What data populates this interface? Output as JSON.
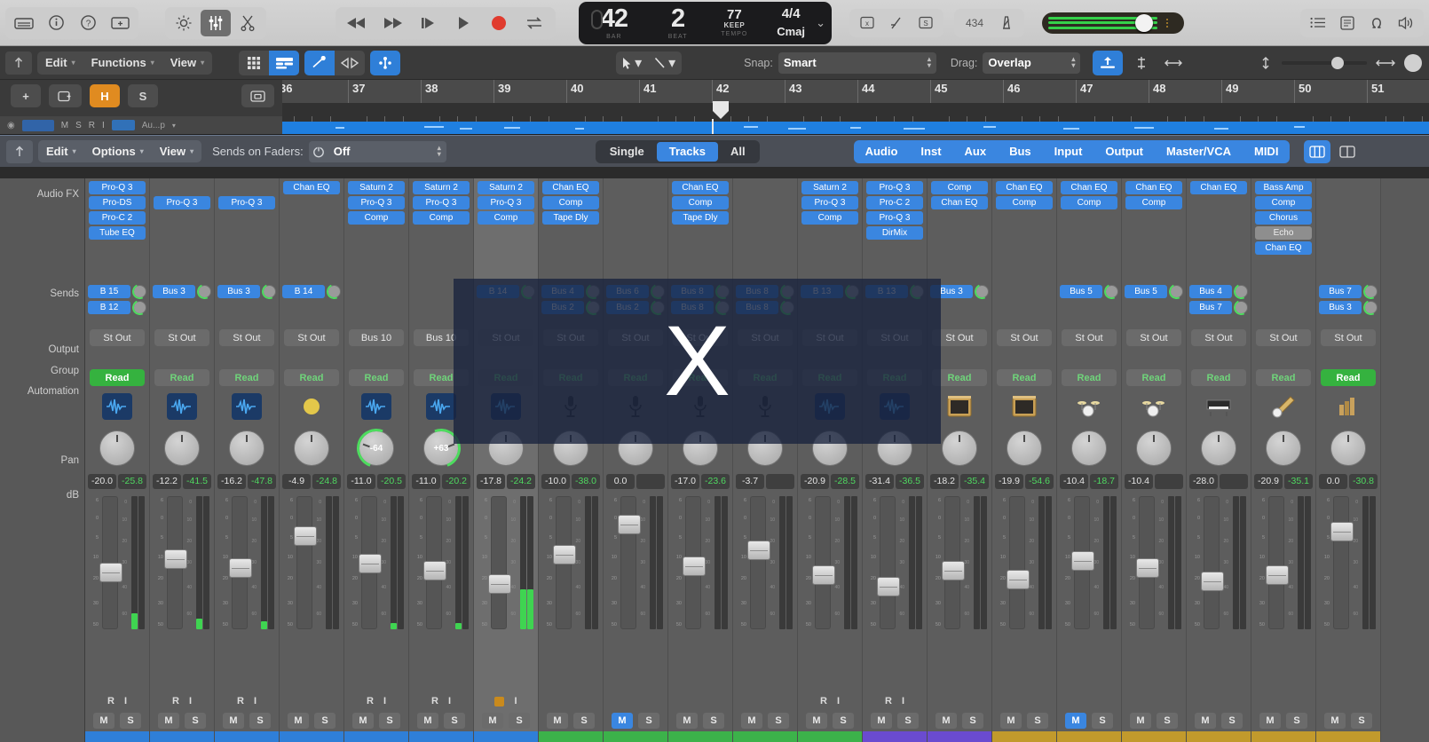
{
  "app": {
    "title": "Logic Pro Mixer"
  },
  "toolbar": {
    "left_icons": [
      {
        "name": "library-icon",
        "glyph": "library"
      },
      {
        "name": "info-icon",
        "glyph": "info"
      },
      {
        "name": "help-icon",
        "glyph": "help"
      },
      {
        "name": "media-icon",
        "glyph": "media"
      }
    ],
    "view_icons": [
      {
        "name": "smart-controls-icon",
        "glyph": "knob",
        "active": false
      },
      {
        "name": "mixer-icon",
        "glyph": "faders",
        "active": true
      },
      {
        "name": "editors-icon",
        "glyph": "scissors",
        "active": false
      }
    ],
    "transport": [
      {
        "name": "rewind-button",
        "glyph": "rewind"
      },
      {
        "name": "forward-button",
        "glyph": "forward"
      },
      {
        "name": "go-to-beginning-button",
        "glyph": "skip-start"
      },
      {
        "name": "play-button",
        "glyph": "play"
      },
      {
        "name": "record-button",
        "glyph": "record"
      },
      {
        "name": "cycle-button",
        "glyph": "cycle"
      }
    ],
    "lcd": {
      "bar_value": "42",
      "bar_label": "BAR",
      "beat_value": "2",
      "beat_label": "BEAT",
      "tempo_value": "77",
      "tempo_mode": "KEEP",
      "tempo_label": "TEMPO",
      "signature": "4/4",
      "key": "Cmaj"
    },
    "mini_icons": [
      {
        "name": "count-in-icon",
        "glyph": "countin"
      },
      {
        "name": "tuner-icon",
        "glyph": "tuner"
      },
      {
        "name": "solo-icon",
        "glyph": "solo"
      }
    ],
    "mini_icons2": [
      {
        "name": "cpu-meter-label",
        "glyph": "text",
        "text": "434"
      },
      {
        "name": "metronome-icon",
        "glyph": "metronome"
      }
    ],
    "master_volume": {
      "name": "master-volume-slider",
      "value": 66
    },
    "right_icons": [
      {
        "name": "list-editors-icon",
        "glyph": "list"
      },
      {
        "name": "notes-icon",
        "glyph": "note-pad"
      },
      {
        "name": "loop-browser-icon",
        "glyph": "omega"
      },
      {
        "name": "media-browser-icon",
        "glyph": "speaker"
      }
    ]
  },
  "editor_bar": {
    "back_icon": "back-arrow-icon",
    "menus": [
      {
        "label": "Edit",
        "name": "menu-edit"
      },
      {
        "label": "Functions",
        "name": "menu-functions"
      },
      {
        "label": "View",
        "name": "menu-view"
      }
    ],
    "view_buttons": [
      {
        "name": "grid-view-button",
        "glyph": "grid",
        "active": false
      },
      {
        "name": "track-view-button",
        "glyph": "tracks",
        "active": true
      },
      {
        "name": "flex-button",
        "glyph": "flex",
        "active": true
      },
      {
        "name": "fade-button",
        "glyph": "fade",
        "active": false
      },
      {
        "name": "flex-pitch-button",
        "glyph": "flexpitch",
        "active": true
      }
    ],
    "tools": [
      {
        "name": "pointer-tool",
        "glyph": "pointer"
      },
      {
        "name": "line-tool",
        "glyph": "line"
      }
    ],
    "snap": {
      "label": "Snap:",
      "value": "Smart",
      "name": "snap-popup"
    },
    "drag": {
      "label": "Drag:",
      "value": "Overlap",
      "name": "drag-popup"
    },
    "right_buttons": [
      {
        "name": "catch-playhead-button",
        "glyph": "catch",
        "active": true
      },
      {
        "name": "align-button",
        "glyph": "align",
        "active": false
      },
      {
        "name": "fit-button",
        "glyph": "fit",
        "active": false
      }
    ],
    "zoom_slider_name": "zoom-slider"
  },
  "track_header": {
    "buttons": [
      {
        "label": "+",
        "name": "add-track-button",
        "style": "plain"
      },
      {
        "label": "",
        "name": "duplicate-track-button",
        "style": "icon"
      },
      {
        "label": "H",
        "name": "hide-button",
        "style": "orange"
      },
      {
        "label": "S",
        "name": "solo-group-button",
        "style": "plain"
      },
      {
        "label": "",
        "name": "automation-button",
        "style": "icon"
      }
    ]
  },
  "ruler": {
    "bars": [
      "36",
      "37",
      "38",
      "39",
      "40",
      "41",
      "42",
      "43",
      "44",
      "45",
      "46",
      "47",
      "48",
      "49",
      "50",
      "51"
    ],
    "playhead_bar": "42"
  },
  "mixer_bar": {
    "back_icon": "back-arrow-icon",
    "menus": [
      {
        "label": "Edit",
        "name": "mixer-menu-edit"
      },
      {
        "label": "Options",
        "name": "mixer-menu-options"
      },
      {
        "label": "View",
        "name": "mixer-menu-view"
      }
    ],
    "sends_on_faders": {
      "label": "Sends on Faders:",
      "power_icon": "power-icon",
      "value": "Off",
      "name": "sends-on-faders-popup"
    },
    "scope": [
      {
        "label": "Single",
        "name": "scope-single",
        "active": false
      },
      {
        "label": "Tracks",
        "name": "scope-tracks",
        "active": true
      },
      {
        "label": "All",
        "name": "scope-all",
        "active": false
      }
    ],
    "filters": [
      {
        "label": "Audio",
        "name": "filter-audio"
      },
      {
        "label": "Inst",
        "name": "filter-inst"
      },
      {
        "label": "Aux",
        "name": "filter-aux"
      },
      {
        "label": "Bus",
        "name": "filter-bus"
      },
      {
        "label": "Input",
        "name": "filter-input"
      },
      {
        "label": "Output",
        "name": "filter-output"
      },
      {
        "label": "Master/VCA",
        "name": "filter-master-vca"
      },
      {
        "label": "MIDI",
        "name": "filter-midi"
      }
    ],
    "view_toggles": [
      {
        "name": "channel-strip-view-toggle",
        "active": true
      },
      {
        "name": "narrow-strip-view-toggle",
        "active": false
      }
    ]
  },
  "row_labels": [
    {
      "label": "Audio FX",
      "name": "row-label-audio-fx"
    },
    {
      "label": "Sends",
      "name": "row-label-sends"
    },
    {
      "label": "Output",
      "name": "row-label-output"
    },
    {
      "label": "Group",
      "name": "row-label-group"
    },
    {
      "label": "Automation",
      "name": "row-label-automation"
    },
    {
      "label": "Pan",
      "name": "row-label-pan"
    },
    {
      "label": "dB",
      "name": "row-label-db"
    }
  ],
  "channels": [
    {
      "fx": [
        "Pro-Q 3",
        "Pro-DS",
        "Pro-C 2",
        "Tube EQ"
      ],
      "sends": [
        {
          "bus": "B 15"
        },
        {
          "bus": "B 12"
        }
      ],
      "output": "St Out",
      "automation": "Read",
      "automation_active": true,
      "icon": "waveform-icon",
      "icon_style": "blue",
      "pan": null,
      "pan_deg": 0,
      "db": "-20.0",
      "meter": "-25.8",
      "meter_green": true,
      "fader": 0.42,
      "meterL": 0.12,
      "meterR": 0.0,
      "ri": true,
      "mute": false,
      "solo": false,
      "color": "#2f7fd8",
      "selected": false
    },
    {
      "fx": [
        "",
        "Pro-Q 3",
        "",
        ""
      ],
      "sends": [
        {
          "bus": "Bus 3"
        }
      ],
      "output": "St Out",
      "automation": "Read",
      "automation_active": false,
      "icon": "waveform-icon",
      "icon_style": "blue",
      "pan": null,
      "pan_deg": 0,
      "db": "-12.2",
      "meter": "-41.5",
      "meter_green": true,
      "fader": 0.54,
      "meterL": 0.08,
      "meterR": 0.0,
      "ri": true,
      "mute": false,
      "solo": false,
      "color": "#2f7fd8",
      "selected": false
    },
    {
      "fx": [
        "",
        "Pro-Q 3",
        "",
        ""
      ],
      "sends": [
        {
          "bus": "Bus 3"
        }
      ],
      "output": "St Out",
      "automation": "Read",
      "automation_active": false,
      "icon": "waveform-icon",
      "icon_style": "blue",
      "pan": null,
      "pan_deg": 0,
      "db": "-16.2",
      "meter": "-47.8",
      "meter_green": true,
      "fader": 0.46,
      "meterL": 0.06,
      "meterR": 0.0,
      "ri": true,
      "mute": false,
      "solo": false,
      "color": "#2f7fd8",
      "selected": false
    },
    {
      "fx": [
        "Chan EQ",
        "",
        "",
        ""
      ],
      "sends": [
        {
          "bus": "B 14"
        }
      ],
      "output": "St Out",
      "automation": "Read",
      "automation_active": false,
      "icon": "drum-icon",
      "icon_style": "yellow",
      "pan": null,
      "pan_deg": 0,
      "db": "-4.9",
      "meter": "-24.8",
      "meter_green": true,
      "fader": 0.74,
      "meterL": 0.0,
      "meterR": 0.0,
      "ri": false,
      "mute": false,
      "solo": false,
      "color": "#2f7fd8",
      "selected": false
    },
    {
      "fx": [
        "Saturn 2",
        "Pro-Q 3",
        "Comp",
        ""
      ],
      "sends": [],
      "output": "Bus 10",
      "automation": "Read",
      "automation_active": false,
      "icon": "waveform-icon",
      "icon_style": "blue",
      "pan": "-64",
      "pan_deg": -70,
      "db": "-11.0",
      "meter": "-20.5",
      "meter_green": true,
      "fader": 0.5,
      "meterL": 0.05,
      "meterR": 0.0,
      "ri": true,
      "mute": false,
      "solo": false,
      "color": "#2f7fd8",
      "selected": false
    },
    {
      "fx": [
        "Saturn 2",
        "Pro-Q 3",
        "Comp",
        ""
      ],
      "sends": [],
      "output": "Bus 10",
      "automation": "Read",
      "automation_active": false,
      "icon": "waveform-icon",
      "icon_style": "blue",
      "pan": "+63",
      "pan_deg": 70,
      "db": "-11.0",
      "meter": "-20.2",
      "meter_green": true,
      "fader": 0.44,
      "meterL": 0.05,
      "meterR": 0.0,
      "ri": true,
      "mute": false,
      "solo": false,
      "color": "#2f7fd8",
      "selected": false
    },
    {
      "fx": [
        "Saturn 2",
        "Pro-Q 3",
        "Comp",
        ""
      ],
      "sends": [
        {
          "bus": "B 14"
        }
      ],
      "output": "St Out",
      "automation": "Read",
      "automation_active": false,
      "icon": "waveform-icon",
      "icon_style": "blue",
      "pan": null,
      "pan_deg": 0,
      "db": "-17.8",
      "meter": "-24.2",
      "meter_green": true,
      "fader": 0.32,
      "meterL": 0.3,
      "meterR": 0.3,
      "ri": false,
      "mute": false,
      "solo": false,
      "color": "#2f7fd8",
      "selected": true
    },
    {
      "fx": [
        "Chan EQ",
        "Comp",
        "Tape Dly",
        ""
      ],
      "sends": [
        {
          "bus": "Bus 4"
        },
        {
          "bus": "Bus 2"
        }
      ],
      "output": "St Out",
      "automation": "Read",
      "automation_active": false,
      "icon": "mic-icon",
      "icon_style": "dark",
      "pan": null,
      "pan_deg": 0,
      "db": "-10.0",
      "meter": "-38.0",
      "meter_green": true,
      "fader": 0.58,
      "meterL": 0.0,
      "meterR": 0.0,
      "ri": false,
      "mute": false,
      "solo": false,
      "color": "#3cb24a",
      "selected": false
    },
    {
      "fx": [
        "",
        "",
        "",
        ""
      ],
      "sends": [
        {
          "bus": "Bus 6"
        },
        {
          "bus": "Bus 2"
        }
      ],
      "output": "St Out",
      "automation": "Read",
      "automation_active": false,
      "icon": "mic-icon",
      "icon_style": "dark",
      "pan": null,
      "pan_deg": 0,
      "db": "0.0",
      "meter": "",
      "meter_green": true,
      "fader": 0.84,
      "meterL": 0.0,
      "meterR": 0.0,
      "ri": false,
      "mute": true,
      "solo": false,
      "color": "#3cb24a",
      "selected": false
    },
    {
      "fx": [
        "Chan EQ",
        "Comp",
        "Tape Dly",
        ""
      ],
      "sends": [
        {
          "bus": "Bus 8"
        },
        {
          "bus": "Bus 8"
        }
      ],
      "output": "St Out",
      "automation": "Read",
      "automation_active": false,
      "icon": "mic-icon",
      "icon_style": "dark",
      "pan": null,
      "pan_deg": 0,
      "db": "-17.0",
      "meter": "-23.6",
      "meter_green": true,
      "fader": 0.48,
      "meterL": 0.0,
      "meterR": 0.0,
      "ri": false,
      "mute": false,
      "solo": false,
      "color": "#3cb24a",
      "selected": false
    },
    {
      "fx": [
        "",
        "",
        "",
        ""
      ],
      "sends": [
        {
          "bus": "Bus 8"
        },
        {
          "bus": "Bus 8"
        }
      ],
      "output": "St Out",
      "automation": "Read",
      "automation_active": false,
      "icon": "mic-icon",
      "icon_style": "dark",
      "pan": null,
      "pan_deg": 0,
      "db": "-3.7",
      "meter": "",
      "meter_green": true,
      "fader": 0.62,
      "meterL": 0.0,
      "meterR": 0.0,
      "ri": false,
      "mute": false,
      "solo": false,
      "color": "#3cb24a",
      "selected": false
    },
    {
      "fx": [
        "Saturn 2",
        "Pro-Q 3",
        "Comp",
        ""
      ],
      "sends": [
        {
          "bus": "B 13"
        }
      ],
      "output": "St Out",
      "automation": "Read",
      "automation_active": false,
      "icon": "waveform-icon",
      "icon_style": "blue",
      "pan": null,
      "pan_deg": 0,
      "db": "-20.9",
      "meter": "-28.5",
      "meter_green": true,
      "fader": 0.4,
      "meterL": 0.0,
      "meterR": 0.0,
      "ri": true,
      "mute": false,
      "solo": false,
      "color": "#3cb24a",
      "selected": false
    },
    {
      "fx": [
        "Pro-Q 3",
        "Pro-C 2",
        "Pro-Q 3",
        "DirMix"
      ],
      "sends": [
        {
          "bus": "B 13"
        }
      ],
      "output": "St Out",
      "automation": "Read",
      "automation_active": false,
      "icon": "waveform-icon",
      "icon_style": "blue",
      "pan": null,
      "pan_deg": 0,
      "db": "-31.4",
      "meter": "-36.5",
      "meter_green": true,
      "fader": 0.3,
      "meterL": 0.0,
      "meterR": 0.0,
      "ri": true,
      "mute": false,
      "solo": false,
      "color": "#6a4bd0",
      "selected": false
    },
    {
      "fx": [
        "Comp",
        "Chan EQ",
        "",
        ""
      ],
      "sends": [
        {
          "bus": "Bus 3"
        }
      ],
      "output": "St Out",
      "automation": "Read",
      "automation_active": false,
      "icon": "amp-icon",
      "icon_style": "img",
      "pan": null,
      "pan_deg": 0,
      "db": "-18.2",
      "meter": "-35.4",
      "meter_green": true,
      "fader": 0.44,
      "meterL": 0.0,
      "meterR": 0.0,
      "ri": false,
      "mute": false,
      "solo": false,
      "color": "#6a4bd0",
      "selected": false
    },
    {
      "fx": [
        "Chan EQ",
        "Comp",
        "",
        ""
      ],
      "sends": [],
      "output": "St Out",
      "automation": "Read",
      "automation_active": false,
      "icon": "amp-icon",
      "icon_style": "img",
      "pan": null,
      "pan_deg": 0,
      "db": "-19.9",
      "meter": "-54.6",
      "meter_green": true,
      "fader": 0.36,
      "meterL": 0.0,
      "meterR": 0.0,
      "ri": false,
      "mute": false,
      "solo": false,
      "color": "#c29a2c",
      "selected": false
    },
    {
      "fx": [
        "Chan EQ",
        "Comp",
        "",
        ""
      ],
      "sends": [
        {
          "bus": "Bus 5"
        }
      ],
      "output": "St Out",
      "automation": "Read",
      "automation_active": false,
      "icon": "drumkit-icon",
      "icon_style": "img",
      "pan": null,
      "pan_deg": 0,
      "db": "-10.4",
      "meter": "-18.7",
      "meter_green": true,
      "fader": 0.52,
      "meterL": 0.0,
      "meterR": 0.0,
      "ri": false,
      "mute": true,
      "solo": false,
      "color": "#c29a2c",
      "selected": false
    },
    {
      "fx": [
        "Chan EQ",
        "Comp",
        "",
        ""
      ],
      "sends": [
        {
          "bus": "Bus 5"
        }
      ],
      "output": "St Out",
      "automation": "Read",
      "automation_active": false,
      "icon": "drumkit-icon",
      "icon_style": "img",
      "pan": null,
      "pan_deg": 0,
      "db": "-10.4",
      "meter": "",
      "meter_green": true,
      "fader": 0.46,
      "meterL": 0.0,
      "meterR": 0.0,
      "ri": false,
      "mute": false,
      "solo": false,
      "color": "#c29a2c",
      "selected": false
    },
    {
      "fx": [
        "Chan EQ",
        "",
        "",
        ""
      ],
      "sends": [
        {
          "bus": "Bus 4"
        },
        {
          "bus": "Bus 7"
        }
      ],
      "output": "St Out",
      "automation": "Read",
      "automation_active": false,
      "icon": "piano-icon",
      "icon_style": "img",
      "pan": null,
      "pan_deg": 0,
      "db": "-28.0",
      "meter": "",
      "meter_green": true,
      "fader": 0.34,
      "meterL": 0.0,
      "meterR": 0.0,
      "ri": false,
      "mute": false,
      "solo": false,
      "color": "#c29a2c",
      "selected": false
    },
    {
      "fx": [
        "Bass Amp",
        "Comp",
        "Chorus",
        "Echo",
        "Chan EQ"
      ],
      "sends": [],
      "output": "St Out",
      "automation": "Read",
      "automation_active": false,
      "icon": "guitar-icon",
      "icon_style": "img",
      "pan": null,
      "pan_deg": 0,
      "db": "-20.9",
      "meter": "-35.1",
      "meter_green": true,
      "fader": 0.4,
      "meterL": 0.0,
      "meterR": 0.0,
      "ri": false,
      "mute": false,
      "solo": false,
      "color": "#c29a2c",
      "selected": false
    },
    {
      "fx": [
        "",
        "",
        "",
        ""
      ],
      "sends": [
        {
          "bus": "Bus 7"
        },
        {
          "bus": "Bus 3"
        }
      ],
      "output": "St Out",
      "automation": "Read",
      "automation_active": true,
      "icon": "bass-icon",
      "icon_style": "img",
      "pan": null,
      "pan_deg": 0,
      "db": "0.0",
      "meter": "-30.8",
      "meter_green": true,
      "fader": 0.78,
      "meterL": 0.0,
      "meterR": 0.0,
      "ri": false,
      "mute": false,
      "solo": false,
      "color": "#c29a2c",
      "selected": false
    }
  ],
  "overlay": {
    "glyph": "X",
    "name": "cursor-x-overlay"
  },
  "colors": {
    "accent_blue": "#3a86e0",
    "slot_blue": "#3a86e0",
    "automation_green": "#35b23f",
    "record_red": "#e03b2e",
    "hide_orange": "#e08b20"
  }
}
